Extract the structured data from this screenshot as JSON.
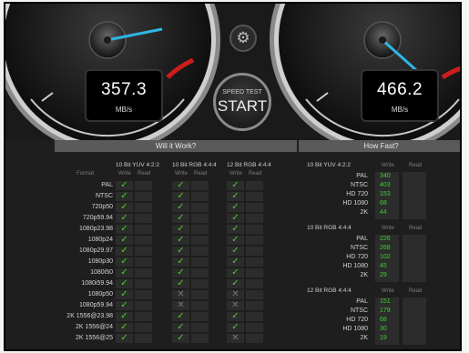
{
  "gauges": {
    "write": {
      "value": "357.3",
      "unit": "MB/s"
    },
    "read": {
      "value": "466.2",
      "unit": "MB/s"
    }
  },
  "start_button": {
    "line1": "SPEED TEST",
    "line2": "START"
  },
  "icons": {
    "settings": "gear-icon",
    "pass": "check-icon",
    "fail": "cross-icon"
  },
  "colors": {
    "needle": "#2fb6e6",
    "check": "#49d12a",
    "value_green": "#35d62e",
    "redline": "#cc1d1d"
  },
  "will_it_work": {
    "title": "Will it Work?",
    "format_header": "Format",
    "groups": [
      {
        "name": "10 Bit YUV 4:2:2",
        "write": "Write",
        "read": "Read"
      },
      {
        "name": "10 Bit RGB 4:4:4",
        "write": "Write",
        "read": "Read"
      },
      {
        "name": "12 Bit RGB 4:4:4",
        "write": "Write",
        "read": "Read"
      }
    ],
    "rows": [
      {
        "format": "PAL",
        "g1": "✓",
        "g2": "✓",
        "g3": "✓"
      },
      {
        "format": "NTSC",
        "g1": "✓",
        "g2": "✓",
        "g3": "✓"
      },
      {
        "format": "720p50",
        "g1": "✓",
        "g2": "✓",
        "g3": "✓"
      },
      {
        "format": "720p59.94",
        "g1": "✓",
        "g2": "✓",
        "g3": "✓"
      },
      {
        "format": "1080p23.98",
        "g1": "✓",
        "g2": "✓",
        "g3": "✓"
      },
      {
        "format": "1080p24",
        "g1": "✓",
        "g2": "✓",
        "g3": "✓"
      },
      {
        "format": "1080p29.97",
        "g1": "✓",
        "g2": "✓",
        "g3": "✓"
      },
      {
        "format": "1080p30",
        "g1": "✓",
        "g2": "✓",
        "g3": "✓"
      },
      {
        "format": "1080i50",
        "g1": "✓",
        "g2": "✓",
        "g3": "✓"
      },
      {
        "format": "1080i59.94",
        "g1": "✓",
        "g2": "✓",
        "g3": "✓"
      },
      {
        "format": "1080p50",
        "g1": "✓",
        "g2": "✕",
        "g3": "✕"
      },
      {
        "format": "1080p59.94",
        "g1": "✓",
        "g2": "✕",
        "g3": "✕"
      },
      {
        "format": "2K 1556@23.98",
        "g1": "✓",
        "g2": "✓",
        "g3": "✓"
      },
      {
        "format": "2K 1556@24",
        "g1": "✓",
        "g2": "✓",
        "g3": "✓"
      },
      {
        "format": "2K 1556@25",
        "g1": "✓",
        "g2": "✓",
        "g3": "✕"
      }
    ]
  },
  "how_fast": {
    "title": "How Fast?",
    "write_header": "Write",
    "read_header": "Read",
    "groups": [
      {
        "name": "10 Bit YUV 4:2:2",
        "rows": [
          {
            "format": "PAL",
            "write": "340"
          },
          {
            "format": "NTSC",
            "write": "403"
          },
          {
            "format": "HD 720",
            "write": "153"
          },
          {
            "format": "HD 1080",
            "write": "68"
          },
          {
            "format": "2K",
            "write": "44"
          }
        ]
      },
      {
        "name": "10 Bit RGB 4:4:4",
        "rows": [
          {
            "format": "PAL",
            "write": "226"
          },
          {
            "format": "NTSC",
            "write": "268"
          },
          {
            "format": "HD 720",
            "write": "102"
          },
          {
            "format": "HD 1080",
            "write": "45"
          },
          {
            "format": "2K",
            "write": "29"
          }
        ]
      },
      {
        "name": "12 Bit RGB 4:4:4",
        "rows": [
          {
            "format": "PAL",
            "write": "151"
          },
          {
            "format": "NTSC",
            "write": "179"
          },
          {
            "format": "HD 720",
            "write": "68"
          },
          {
            "format": "HD 1080",
            "write": "30"
          },
          {
            "format": "2K",
            "write": "19"
          }
        ]
      }
    ]
  }
}
